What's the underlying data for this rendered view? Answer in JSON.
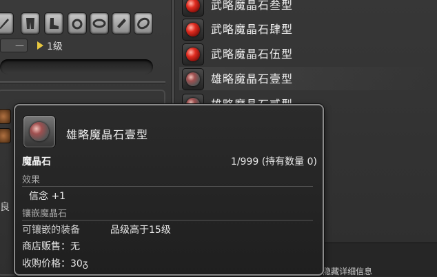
{
  "left_panel": {
    "level_minus": "—",
    "level_label": "1级",
    "side_glyph": "良"
  },
  "materia_list": [
    {
      "label": "武略魔晶石叁型",
      "color": "red"
    },
    {
      "label": "武略魔晶石肆型",
      "color": "red"
    },
    {
      "label": "武略魔晶石伍型",
      "color": "red"
    },
    {
      "label": "雄略魔晶石壹型",
      "color": "grey",
      "selected": true
    },
    {
      "label": "雄略魔晶石贰型",
      "color": "grey"
    }
  ],
  "bottom_hint": "Alt键 隐藏详细信息",
  "tooltip": {
    "title": "雄略魔晶石壹型",
    "category": "魔晶石",
    "quantity": "1/999 (持有数量 0)",
    "effect_header": "效果",
    "effect_value": "信念 +1",
    "meld_header": "镶嵌魔晶石",
    "meld_label": "可镶嵌的装备",
    "meld_value": "品级高于15级",
    "shop_sale": "商店贩售：无",
    "buyback_price": "收购价格：30ᵹ"
  },
  "colors": {
    "accent_arrow": "#e8c840",
    "gem_red": "#e02c20",
    "tooltip_border": "#8a8a8a"
  }
}
